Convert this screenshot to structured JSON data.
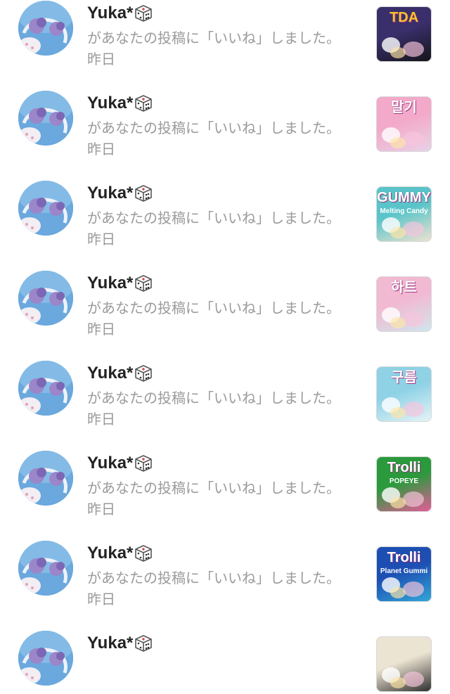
{
  "notifications": [
    {
      "username": "Yuka*",
      "message": "があなたの投稿に「いいね」しました。",
      "time": "昨日",
      "thumb": {
        "text": "TDA",
        "sub": "",
        "bg": "#3a2f6b",
        "bg2": "#141418",
        "text_color": "#f4c52a"
      }
    },
    {
      "username": "Yuka*",
      "message": "があなたの投稿に「いいね」しました。",
      "time": "昨日",
      "thumb": {
        "text": "말기",
        "sub": "",
        "bg": "#f3a9c9",
        "bg2": "#e7d3e8",
        "text_color": "#ffffff"
      }
    },
    {
      "username": "Yuka*",
      "message": "があなたの投稿に「いいね」しました。",
      "time": "昨日",
      "thumb": {
        "text": "GUMMY",
        "sub": "Melting Candy",
        "bg": "#59c4c9",
        "bg2": "#f1e3d0",
        "text_color": "#ffffff"
      }
    },
    {
      "username": "Yuka*",
      "message": "があなたの投稿に「いいね」しました。",
      "time": "昨日",
      "thumb": {
        "text": "하트",
        "sub": "",
        "bg": "#f2b9d2",
        "bg2": "#cfe6ee",
        "text_color": "#ffffff"
      }
    },
    {
      "username": "Yuka*",
      "message": "があなたの投稿に「いいね」しました。",
      "time": "昨日",
      "thumb": {
        "text": "구름",
        "sub": "",
        "bg": "#8fd2e6",
        "bg2": "#e6f4f7",
        "text_color": "#ffffff"
      }
    },
    {
      "username": "Yuka*",
      "message": "があなたの投稿に「いいね」しました。",
      "time": "昨日",
      "thumb": {
        "text": "Trolli",
        "sub": "POPEYE",
        "bg": "#2a9a3c",
        "bg2": "#e85a9a",
        "text_color": "#ffffff"
      }
    },
    {
      "username": "Yuka*",
      "message": "があなたの投稿に「いいね」しました。",
      "time": "昨日",
      "thumb": {
        "text": "Trolli",
        "sub": "Planet Gummi",
        "bg": "#1d4fb3",
        "bg2": "#32a8d8",
        "text_color": "#ffffff"
      }
    },
    {
      "username": "Yuka*",
      "message": "",
      "time": "",
      "thumb": {
        "text": "",
        "sub": "",
        "bg": "#ece4d2",
        "bg2": "#2b2b2b",
        "text_color": "#ffffff"
      }
    }
  ]
}
